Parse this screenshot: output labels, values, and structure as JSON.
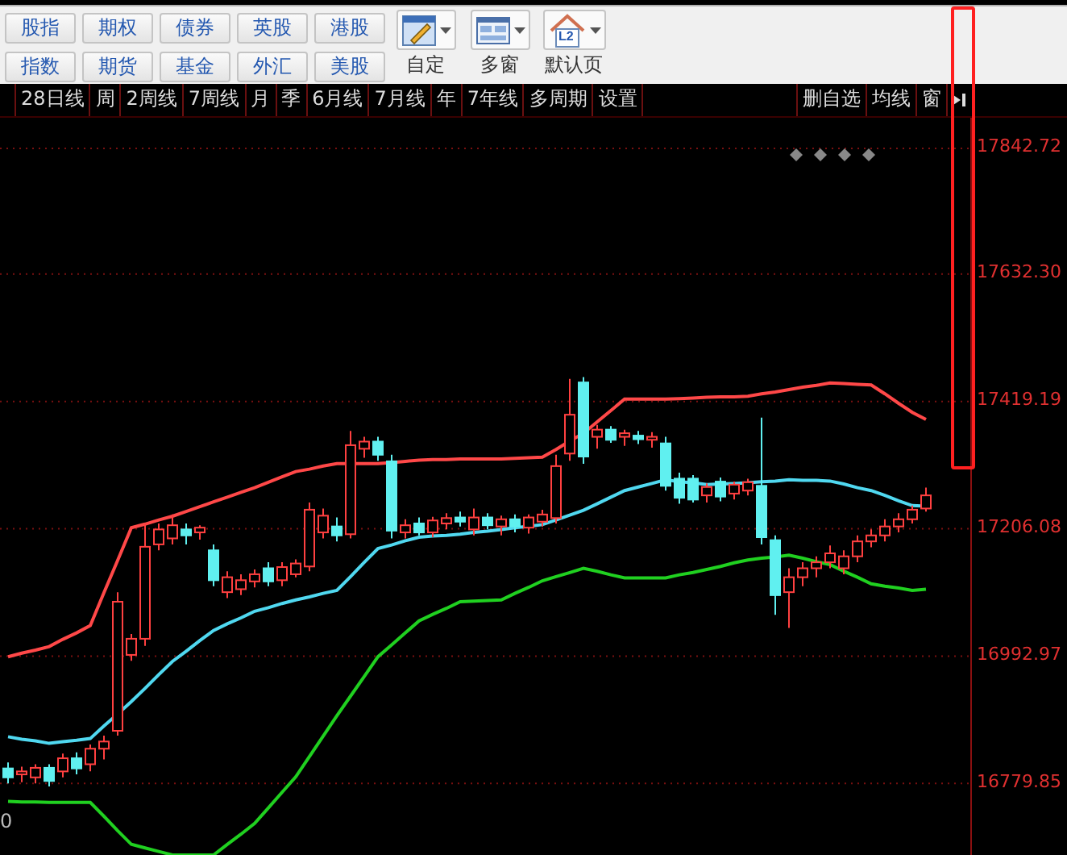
{
  "toolbar": {
    "market_buttons": [
      {
        "label": "股指"
      },
      {
        "label": "期权"
      },
      {
        "label": "债券"
      },
      {
        "label": "英股"
      },
      {
        "label": "港股"
      },
      {
        "label": "指数"
      },
      {
        "label": "期货"
      },
      {
        "label": "基金"
      },
      {
        "label": "外汇"
      },
      {
        "label": "美股"
      }
    ],
    "tool_buttons": [
      {
        "kind": "edit",
        "label": "自定"
      },
      {
        "kind": "layout",
        "label": "多窗"
      },
      {
        "kind": "home",
        "label": "默认页",
        "badge": "L2"
      }
    ]
  },
  "period_tabs": [
    "28日线",
    "周",
    "2周线",
    "7周线",
    "月",
    "季",
    "6月线",
    "7月线",
    "年",
    "7年线",
    "多周期",
    "设置"
  ],
  "right_tabs": [
    "删自选",
    "均线",
    "窗"
  ],
  "chart_data": {
    "type": "candlestick",
    "grid": true,
    "ylim": [
      16657.4,
      17894
    ],
    "yticks": [
      {
        "value": 17842.72,
        "label": "17842.72"
      },
      {
        "value": 17632.3,
        "label": "17632.30"
      },
      {
        "value": 17419.19,
        "label": "17419.19"
      },
      {
        "value": 17206.08,
        "label": "17206.08"
      },
      {
        "value": 16992.97,
        "label": "16992.97"
      },
      {
        "value": 16779.85,
        "label": "16779.85"
      }
    ],
    "categories": [
      null,
      null,
      null,
      null,
      null,
      null,
      null,
      null,
      null,
      null,
      null,
      null,
      null,
      null,
      null,
      null,
      null,
      null,
      null,
      null,
      null,
      null,
      null,
      null,
      null,
      null,
      null,
      null,
      null,
      null,
      null,
      null,
      null,
      null,
      null,
      null,
      null,
      null,
      null,
      null,
      null,
      null,
      null,
      null,
      null,
      null,
      null,
      null,
      null,
      null,
      null,
      null,
      null,
      null,
      null,
      null,
      null,
      null,
      null,
      null,
      null,
      null,
      null,
      null,
      null,
      null,
      null,
      null
    ],
    "ohlc": [
      [
        16805,
        16815,
        16780,
        16790
      ],
      [
        16795,
        16808,
        16782,
        16800
      ],
      [
        16790,
        16812,
        16780,
        16806
      ],
      [
        16806,
        16812,
        16775,
        16784
      ],
      [
        16800,
        16830,
        16790,
        16822
      ],
      [
        16822,
        16832,
        16795,
        16805
      ],
      [
        16812,
        16845,
        16800,
        16838
      ],
      [
        16838,
        16860,
        16820,
        16850
      ],
      [
        16868,
        17100,
        16860,
        17084
      ],
      [
        16995,
        17030,
        16985,
        17022
      ],
      [
        17022,
        17215,
        17010,
        17176
      ],
      [
        17180,
        17215,
        17170,
        17205
      ],
      [
        17190,
        17230,
        17180,
        17212
      ],
      [
        17205,
        17215,
        17180,
        17195
      ],
      [
        17200,
        17212,
        17188,
        17208
      ],
      [
        17170,
        17180,
        17110,
        17120
      ],
      [
        17100,
        17135,
        17090,
        17125
      ],
      [
        17105,
        17130,
        17095,
        17120
      ],
      [
        17118,
        17138,
        17108,
        17130
      ],
      [
        17140,
        17150,
        17110,
        17118
      ],
      [
        17120,
        17150,
        17110,
        17142
      ],
      [
        17130,
        17155,
        17125,
        17148
      ],
      [
        17143,
        17250,
        17135,
        17238
      ],
      [
        17200,
        17240,
        17190,
        17228
      ],
      [
        17210,
        17225,
        17185,
        17195
      ],
      [
        17197,
        17370,
        17190,
        17346
      ],
      [
        17340,
        17360,
        17325,
        17352
      ],
      [
        17352,
        17360,
        17320,
        17330
      ],
      [
        17319,
        17330,
        17190,
        17203
      ],
      [
        17200,
        17222,
        17190,
        17212
      ],
      [
        17215,
        17225,
        17195,
        17200
      ],
      [
        17200,
        17226,
        17192,
        17220
      ],
      [
        17215,
        17232,
        17205,
        17224
      ],
      [
        17225,
        17235,
        17210,
        17218
      ],
      [
        17205,
        17240,
        17195,
        17225
      ],
      [
        17225,
        17232,
        17205,
        17212
      ],
      [
        17210,
        17228,
        17195,
        17222
      ],
      [
        17222,
        17230,
        17200,
        17210
      ],
      [
        17208,
        17230,
        17198,
        17225
      ],
      [
        17218,
        17238,
        17210,
        17230
      ],
      [
        17224,
        17330,
        17215,
        17311
      ],
      [
        17332,
        17457,
        17320,
        17397
      ],
      [
        17451,
        17460,
        17315,
        17327
      ],
      [
        17360,
        17380,
        17340,
        17372
      ],
      [
        17372,
        17378,
        17350,
        17355
      ],
      [
        17360,
        17372,
        17345,
        17366
      ],
      [
        17362,
        17370,
        17348,
        17356
      ],
      [
        17355,
        17368,
        17342,
        17360
      ],
      [
        17349,
        17360,
        17270,
        17278
      ],
      [
        17290,
        17300,
        17248,
        17258
      ],
      [
        17290,
        17296,
        17250,
        17255
      ],
      [
        17262,
        17282,
        17250,
        17276
      ],
      [
        17285,
        17292,
        17252,
        17260
      ],
      [
        17265,
        17285,
        17255,
        17280
      ],
      [
        17270,
        17290,
        17262,
        17284
      ],
      [
        17278,
        17392,
        17180,
        17192
      ],
      [
        17187,
        17195,
        17062,
        17095
      ],
      [
        17100,
        17140,
        17040,
        17125
      ],
      [
        17125,
        17150,
        17110,
        17140
      ],
      [
        17140,
        17160,
        17125,
        17150
      ],
      [
        17150,
        17178,
        17140,
        17165
      ],
      [
        17140,
        17170,
        17130,
        17160
      ],
      [
        17160,
        17195,
        17150,
        17185
      ],
      [
        17185,
        17205,
        17175,
        17195
      ],
      [
        17195,
        17222,
        17185,
        17210
      ],
      [
        17210,
        17232,
        17200,
        17222
      ],
      [
        17222,
        17245,
        17215,
        17238
      ],
      [
        17240,
        17275,
        17235,
        17262
      ]
    ],
    "series": [
      {
        "type": "line",
        "color": "#ff4848",
        "values": [
          16992,
          16998,
          17003,
          17009,
          17021,
          17032,
          17044,
          17099,
          17153,
          17208,
          17214,
          17221,
          17227,
          17235,
          17243,
          17251,
          17259,
          17267,
          17275,
          17284,
          17293,
          17302,
          17306,
          17311,
          17315,
          17315,
          17315,
          17315,
          17317,
          17319,
          17321,
          17322,
          17322,
          17323,
          17323,
          17323,
          17323,
          17324,
          17325,
          17326,
          17339,
          17353,
          17366,
          17385,
          17404,
          17423,
          17423,
          17423,
          17423,
          17424,
          17425,
          17426,
          17427,
          17427,
          17428,
          17432,
          17435,
          17439,
          17443,
          17446,
          17450,
          17449,
          17448,
          17447,
          17432,
          17416,
          17401,
          17389
        ]
      },
      {
        "type": "line",
        "color": "#50d8f0",
        "values": [
          16858,
          16854,
          16851,
          16847,
          16850,
          16852,
          16855,
          16876,
          16896,
          16917,
          16939,
          16962,
          16984,
          17001,
          17019,
          17036,
          17047,
          17057,
          17068,
          17074,
          17081,
          17087,
          17092,
          17098,
          17103,
          17126,
          17150,
          17173,
          17179,
          17186,
          17192,
          17194,
          17195,
          17197,
          17200,
          17202,
          17205,
          17208,
          17210,
          17213,
          17221,
          17229,
          17237,
          17248,
          17259,
          17270,
          17276,
          17282,
          17288,
          17285,
          17283,
          17280,
          17281,
          17282,
          17283,
          17285,
          17286,
          17288,
          17287,
          17287,
          17286,
          17281,
          17275,
          17270,
          17262,
          17253,
          17245,
          17244
        ]
      },
      {
        "type": "line",
        "color": "#20d020",
        "values": [
          16750,
          16749,
          16749,
          16748,
          16748,
          16748,
          16748,
          16725,
          16701,
          16678,
          16672,
          16666,
          16660,
          16660,
          16660,
          16660,
          16678,
          16695,
          16713,
          16739,
          16765,
          16791,
          16825,
          16859,
          16893,
          16926,
          16959,
          16992,
          17012,
          17032,
          17052,
          17063,
          17073,
          17084,
          17085,
          17086,
          17087,
          17098,
          17108,
          17119,
          17126,
          17133,
          17140,
          17135,
          17129,
          17124,
          17124,
          17124,
          17124,
          17129,
          17133,
          17138,
          17143,
          17149,
          17154,
          17157,
          17159,
          17162,
          17157,
          17151,
          17146,
          17135,
          17125,
          17114,
          17110,
          17107,
          17103,
          17105
        ]
      }
    ]
  },
  "corner_label": "0"
}
